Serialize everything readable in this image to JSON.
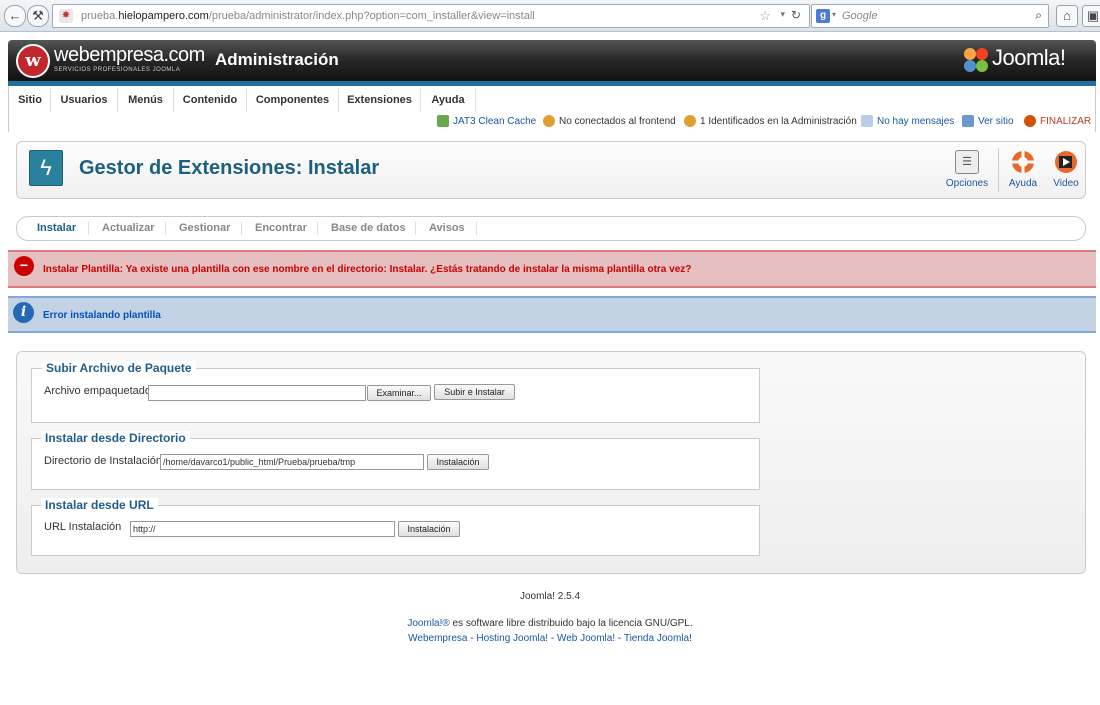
{
  "browser": {
    "url_prefix": "prueba.",
    "url_domain": "hielopampero.com",
    "url_path": "/prueba/administrator/index.php?option=com_installer&view=install",
    "search_placeholder": "Google"
  },
  "header": {
    "brand": "webempresa.com",
    "brand_sub": "SERVICIOS PROFESIONALES JOOMLA",
    "title": "Administración",
    "joomla_logo": "Joomla!"
  },
  "menu": {
    "items": [
      "Sitio",
      "Usuarios",
      "Menús",
      "Contenido",
      "Componentes",
      "Extensiones",
      "Ayuda"
    ]
  },
  "status": {
    "cache": "JAT3 Clean Cache",
    "frontend": "No conectados al frontend",
    "admins": "1 Identificados en la Administración",
    "messages": "No hay mensajes",
    "view_site": "Ver sitio",
    "logout": "FINALIZAR"
  },
  "toolbar": {
    "title": "Gestor de Extensiones: Instalar",
    "options": "Opciones",
    "help": "Ayuda",
    "video": "Video"
  },
  "subtabs": [
    "Instalar",
    "Actualizar",
    "Gestionar",
    "Encontrar",
    "Base de datos",
    "Avisos"
  ],
  "messages": {
    "error": "Instalar Plantilla: Ya existe una plantilla con ese nombre en el directorio: Instalar. ¿Estás tratando de instalar la misma plantilla otra vez?",
    "info": "Error instalando plantilla"
  },
  "forms": {
    "upload": {
      "legend": "Subir Archivo de Paquete",
      "label": "Archivo empaquetado",
      "value": "",
      "browse": "Examinar...",
      "submit": "Subir e Instalar"
    },
    "directory": {
      "legend": "Instalar desde Directorio",
      "label": "Directorio de Instalación",
      "value": "/home/davarco1/public_html/Prueba/prueba/tmp",
      "submit": "Instalación"
    },
    "url": {
      "legend": "Instalar desde URL",
      "label": "URL Instalación",
      "value": "http://",
      "submit": "Instalación"
    }
  },
  "footer": {
    "version": "Joomla! 2.5.4",
    "license_link": "Joomla!®",
    "license_text": " es software libre distribuido bajo la licencia GNU/GPL.",
    "links": [
      "Webempresa",
      "Hosting Joomla!",
      "Web Joomla!",
      "Tienda Joomla!"
    ],
    "sep": " - "
  }
}
